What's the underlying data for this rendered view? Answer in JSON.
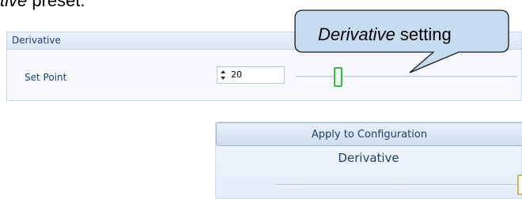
{
  "document": {
    "caption_italic": "tive",
    "caption_rest": " preset."
  },
  "derivative_group": {
    "title": "Derivative",
    "setpoint": {
      "label": "Set Point",
      "value": "20",
      "slider_fraction": 0.17
    }
  },
  "callout": {
    "italic_part": "Derivative",
    "rest": " setting",
    "fill_color": "#c6dcf1"
  },
  "apply_panel": {
    "apply_button_label": "Apply to Configuration",
    "derivative_label": "Derivative",
    "slider_fraction": 1.0
  },
  "colors": {
    "accent_text": "#1e3f6e",
    "thumb_active": "#37b84a",
    "thumb_max": "#c9b46a"
  }
}
